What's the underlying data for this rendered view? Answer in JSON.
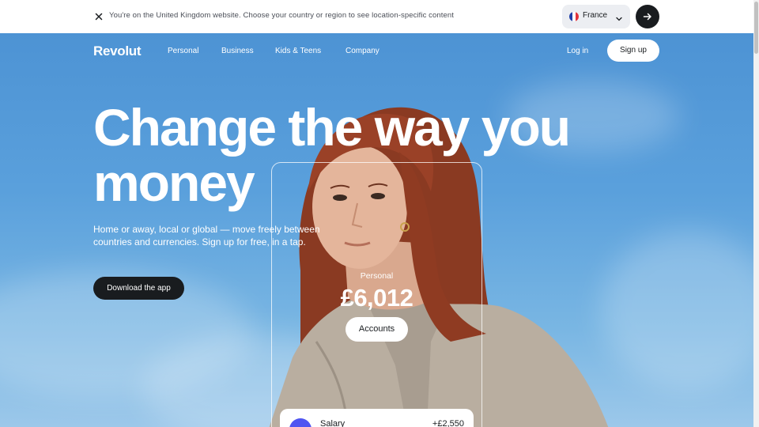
{
  "banner": {
    "message": "You're on the United Kingdom website. Choose your country or region to see location-specific content",
    "country": "France",
    "close_icon": "close-icon",
    "go_icon": "arrow-right-icon"
  },
  "nav": {
    "logo": "Revolut",
    "items": [
      "Personal",
      "Business",
      "Kids & Teens",
      "Company"
    ],
    "login": "Log in",
    "signup": "Sign up"
  },
  "hero": {
    "headline_line1": "Change the way you",
    "headline_line2": "money",
    "subtext": "Home or away, local or global — move freely between countries and currencies. Sign up for free, in a tap.",
    "cta": "Download the app"
  },
  "card": {
    "label": "Personal",
    "amount": "£6,012",
    "button": "Accounts"
  },
  "transaction": {
    "name": "Salary",
    "amount": "+£2,550"
  },
  "colors": {
    "dark": "#191c1f",
    "sky": "#4d93d4",
    "accent": "#4f55f1"
  }
}
